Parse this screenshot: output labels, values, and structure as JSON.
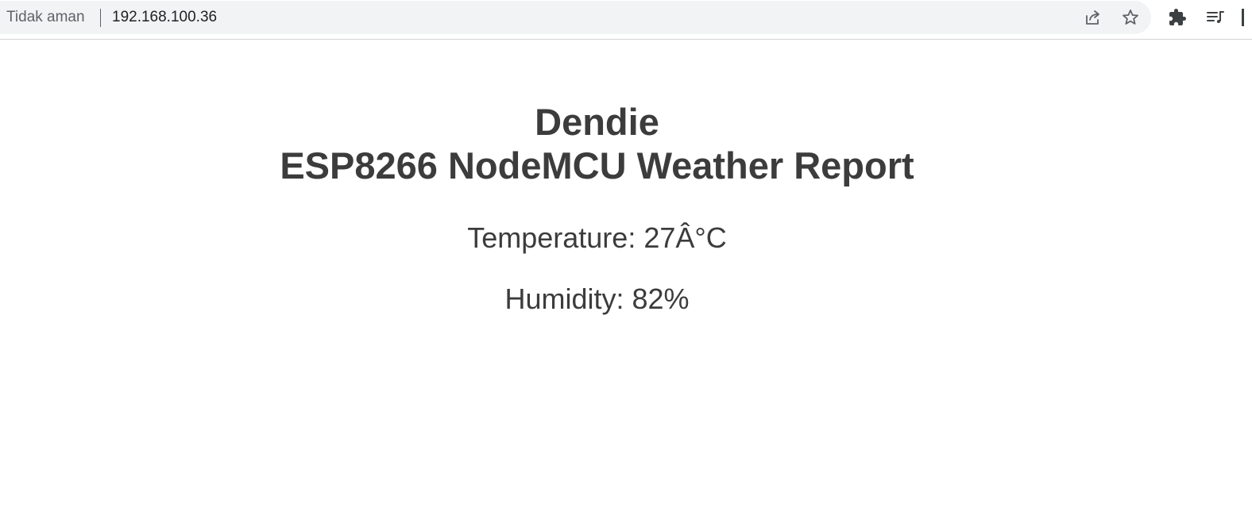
{
  "browser": {
    "security_label": "Tidak aman",
    "url": "192.168.100.36",
    "icons": [
      "share-icon",
      "bookmark-star-icon",
      "extensions-puzzle-icon",
      "media-controls-icon"
    ]
  },
  "page": {
    "title_line1": "Dendie",
    "title_line2": "ESP8266 NodeMCU Weather Report",
    "temperature_text": "Temperature: 27Â°C",
    "humidity_text": "Humidity: 82%"
  },
  "colors": {
    "text": "#3c3c3c",
    "omnibox_bg": "#f1f3f4",
    "page_bg": "#ffffff"
  }
}
